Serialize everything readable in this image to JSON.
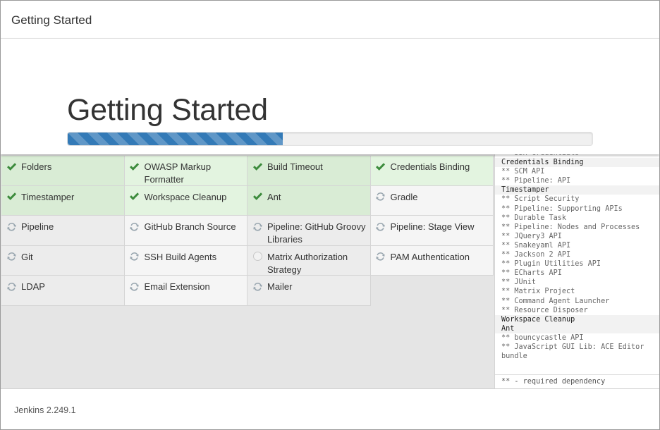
{
  "header": {
    "title": "Getting Started"
  },
  "hero": {
    "title": "Getting Started",
    "progress_percent": 41
  },
  "plugins": [
    {
      "label": "Folders",
      "status": "success"
    },
    {
      "label": "OWASP Markup Formatter",
      "status": "success"
    },
    {
      "label": "Build Timeout",
      "status": "success"
    },
    {
      "label": "Credentials Binding",
      "status": "success"
    },
    {
      "label": "Timestamper",
      "status": "success"
    },
    {
      "label": "Workspace Cleanup",
      "status": "success"
    },
    {
      "label": "Ant",
      "status": "success"
    },
    {
      "label": "Gradle",
      "status": "pending"
    },
    {
      "label": "Pipeline",
      "status": "pending"
    },
    {
      "label": "GitHub Branch Source",
      "status": "pending"
    },
    {
      "label": "Pipeline: GitHub Groovy Libraries",
      "status": "pending"
    },
    {
      "label": "Pipeline: Stage View",
      "status": "pending"
    },
    {
      "label": "Git",
      "status": "pending"
    },
    {
      "label": "SSH Build Agents",
      "status": "pending"
    },
    {
      "label": "Matrix Authorization Strategy",
      "status": "idle"
    },
    {
      "label": "PAM Authentication",
      "status": "pending"
    },
    {
      "label": "LDAP",
      "status": "pending"
    },
    {
      "label": "Email Extension",
      "status": "pending"
    },
    {
      "label": "Mailer",
      "status": "pending"
    }
  ],
  "log": {
    "lines": [
      {
        "text": "** SSH Credentials",
        "type": "dep"
      },
      {
        "text": "Credentials Binding",
        "type": "head"
      },
      {
        "text": "** SCM API",
        "type": "dep"
      },
      {
        "text": "** Pipeline: API",
        "type": "dep"
      },
      {
        "text": "Timestamper",
        "type": "head"
      },
      {
        "text": "** Script Security",
        "type": "dep"
      },
      {
        "text": "** Pipeline: Supporting APIs",
        "type": "dep"
      },
      {
        "text": "** Durable Task",
        "type": "dep"
      },
      {
        "text": "** Pipeline: Nodes and Processes",
        "type": "dep"
      },
      {
        "text": "** JQuery3 API",
        "type": "dep"
      },
      {
        "text": "** Snakeyaml API",
        "type": "dep"
      },
      {
        "text": "** Jackson 2 API",
        "type": "dep"
      },
      {
        "text": "** Plugin Utilities API",
        "type": "dep"
      },
      {
        "text": "** ECharts API",
        "type": "dep"
      },
      {
        "text": "** JUnit",
        "type": "dep"
      },
      {
        "text": "** Matrix Project",
        "type": "dep"
      },
      {
        "text": "** Command Agent Launcher",
        "type": "dep"
      },
      {
        "text": "** Resource Disposer",
        "type": "dep"
      },
      {
        "text": "Workspace Cleanup",
        "type": "head"
      },
      {
        "text": "Ant",
        "type": "head"
      },
      {
        "text": "** bouncycastle API",
        "type": "dep"
      },
      {
        "text": "** JavaScript GUI Lib: ACE Editor bundle",
        "type": "dep wrap"
      }
    ],
    "note": "** - required dependency"
  },
  "footer": {
    "version": "Jenkins 2.249.1"
  },
  "colors": {
    "accent": "#337ab7",
    "success": "#3c8b3c"
  }
}
